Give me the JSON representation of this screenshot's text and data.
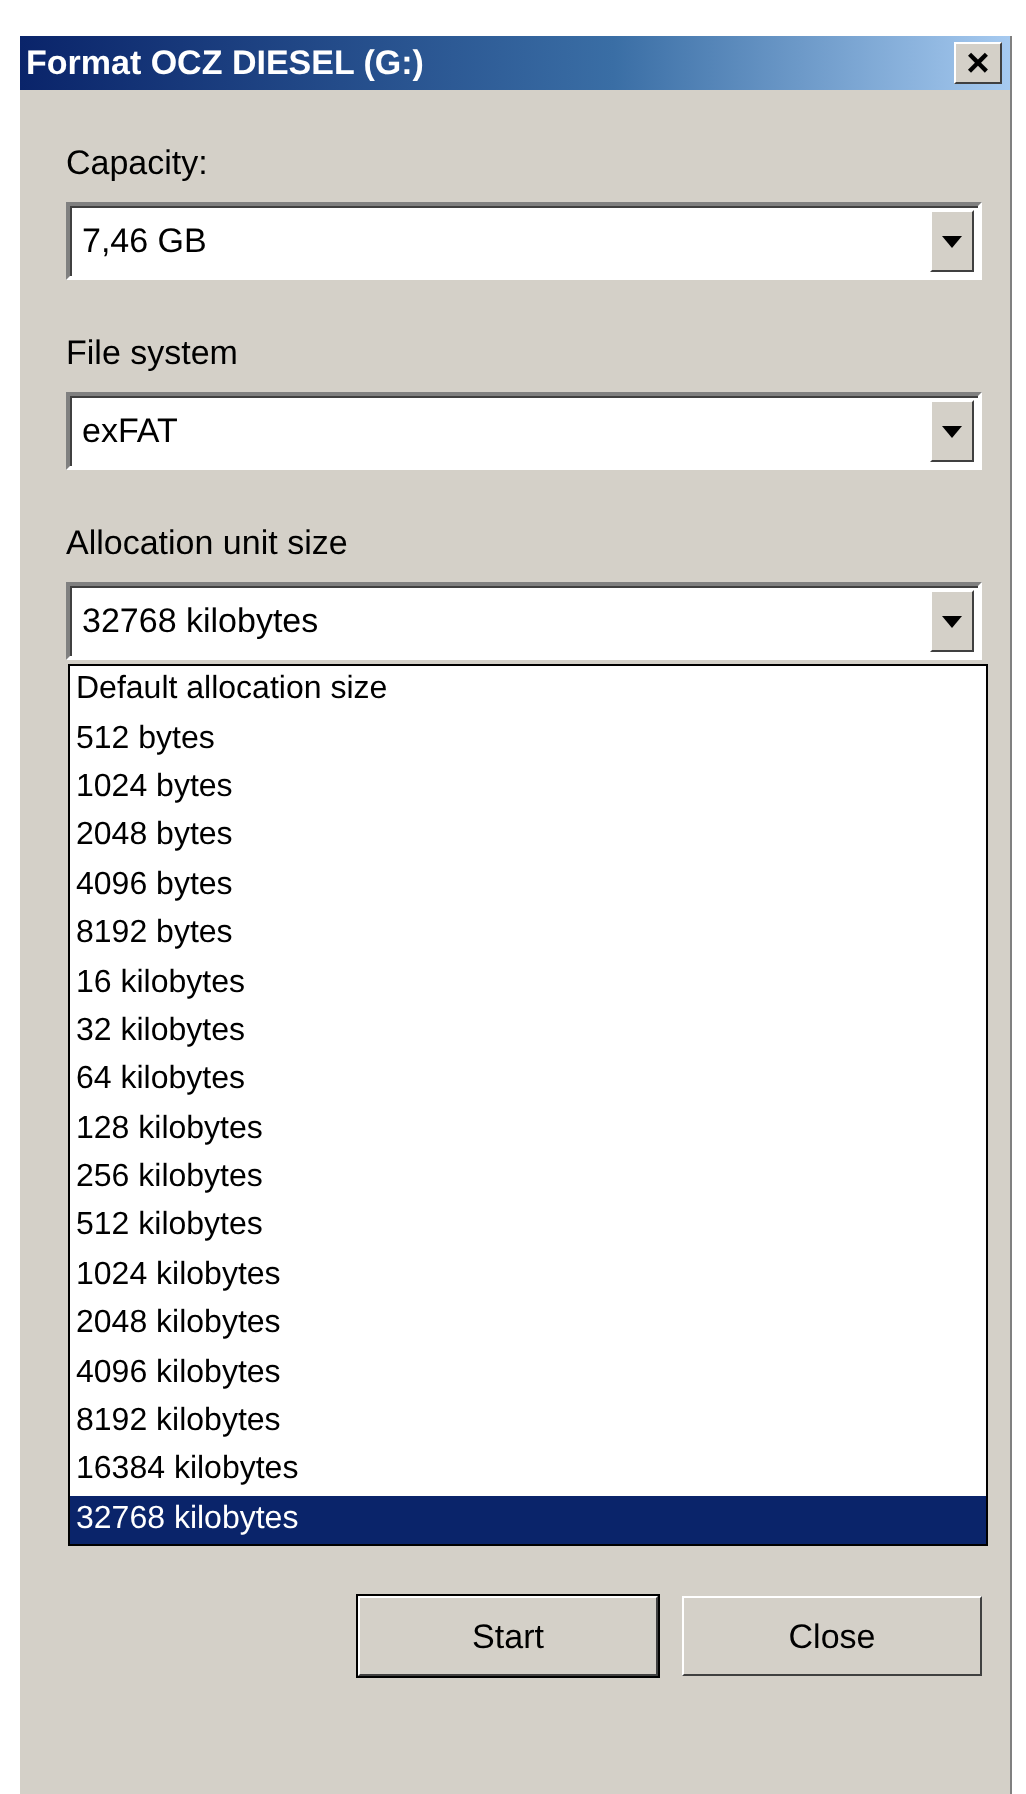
{
  "window": {
    "title": "Format OCZ DIESEL (G:)",
    "close": "×"
  },
  "fields": [
    {
      "label": "Capacity:",
      "value": "7,46 GB"
    },
    {
      "label": "File system",
      "value": "exFAT"
    },
    {
      "label": "Allocation unit size",
      "value": "32768 kilobytes",
      "expanded": true
    }
  ],
  "dropdown_items": [
    {
      "label": "Default allocation size",
      "selected": false
    },
    {
      "label": "512 bytes",
      "selected": false
    },
    {
      "label": "1024 bytes",
      "selected": false
    },
    {
      "label": "2048 bytes",
      "selected": false
    },
    {
      "label": "4096 bytes",
      "selected": false
    },
    {
      "label": "8192 bytes",
      "selected": false
    },
    {
      "label": "16 kilobytes",
      "selected": false
    },
    {
      "label": "32 kilobytes",
      "selected": false
    },
    {
      "label": "64 kilobytes",
      "selected": false
    },
    {
      "label": "128 kilobytes",
      "selected": false
    },
    {
      "label": "256 kilobytes",
      "selected": false
    },
    {
      "label": "512 kilobytes",
      "selected": false
    },
    {
      "label": "1024 kilobytes",
      "selected": false
    },
    {
      "label": "2048 kilobytes",
      "selected": false
    },
    {
      "label": "4096 kilobytes",
      "selected": false
    },
    {
      "label": "8192 kilobytes",
      "selected": false
    },
    {
      "label": "16384 kilobytes",
      "selected": false
    },
    {
      "label": "32768 kilobytes",
      "selected": true
    }
  ],
  "buttons": [
    {
      "label": "Start",
      "default": true
    },
    {
      "label": "Close",
      "default": false
    }
  ]
}
